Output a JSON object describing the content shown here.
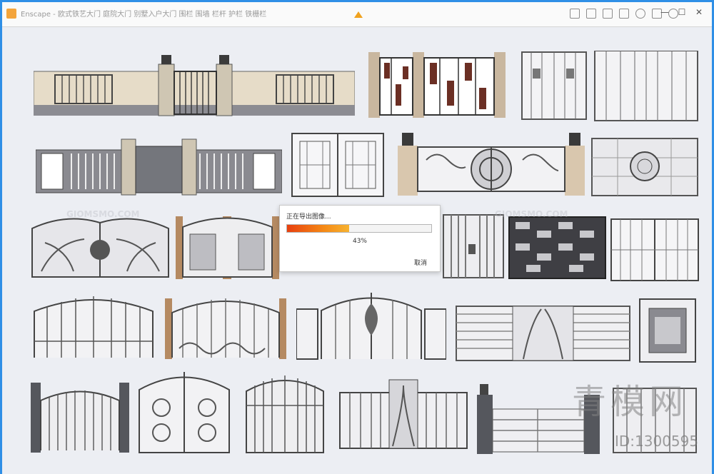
{
  "window": {
    "title": "Enscape - 欧式铁艺大门 庭院大门 别墅入户大门 围栏 围墙 栏杆 护栏 铁栅栏",
    "minimize": "—",
    "maximize": "☐",
    "close": "✕"
  },
  "dialog": {
    "title": "正在导出图像...",
    "progress_percent": 43,
    "progress_text": "43%",
    "cancel_label": "取消"
  },
  "watermark": {
    "site": "GIOMSMO.COM",
    "brand": "青模网",
    "id_text": "ID:1300595"
  },
  "colors": {
    "accent": "#f0a21e",
    "frame": "#2f8fe6",
    "progress_start": "#e8400f",
    "progress_end": "#f7b331"
  }
}
